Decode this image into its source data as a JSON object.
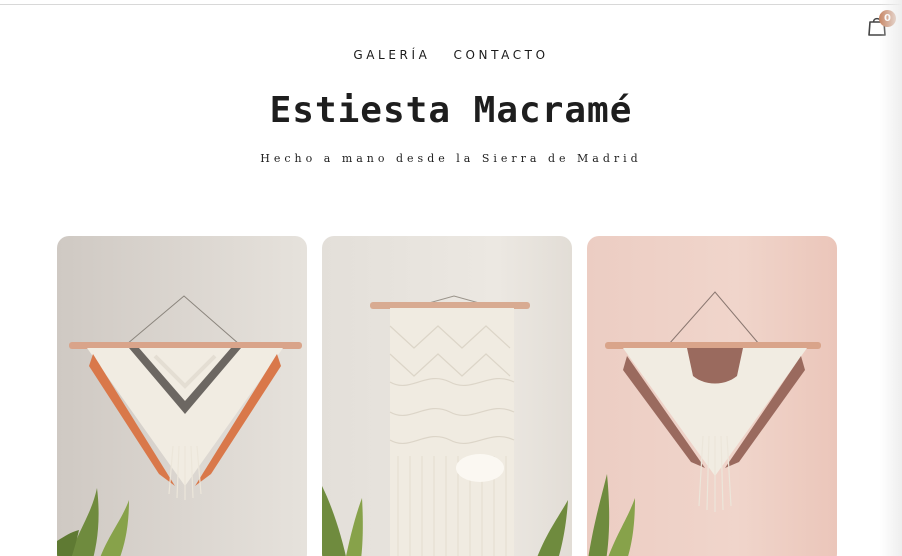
{
  "nav": {
    "items": [
      {
        "label": "GALERÍA"
      },
      {
        "label": "CONTACTO"
      }
    ]
  },
  "header": {
    "title": "Estiesta Macramé",
    "tagline": "Hecho a mano desde la Sierra de Madrid"
  },
  "cart": {
    "count": "0",
    "icon": "shopping-bag-icon"
  },
  "gallery": {
    "items": [
      {
        "subject": "wall hanging with rust and grey fringe",
        "icon": "macrame-photo"
      },
      {
        "subject": "long cream wall hanging",
        "icon": "macrame-photo"
      },
      {
        "subject": "wall hanging with mauve fringe",
        "icon": "macrame-photo"
      }
    ]
  },
  "colors": {
    "text": "#1a1a1a",
    "badge": "#c98b6b",
    "wall_left": "#d8d3cd",
    "wall_mid": "#ebe7e1",
    "wall_right": "#efcfc4",
    "rope": "#f1ece2",
    "rust": "#d9784a",
    "grey": "#6c6762",
    "mauve": "#9a6a5e",
    "rod": "#d9a48a",
    "leaf": "#6f8b3e"
  }
}
